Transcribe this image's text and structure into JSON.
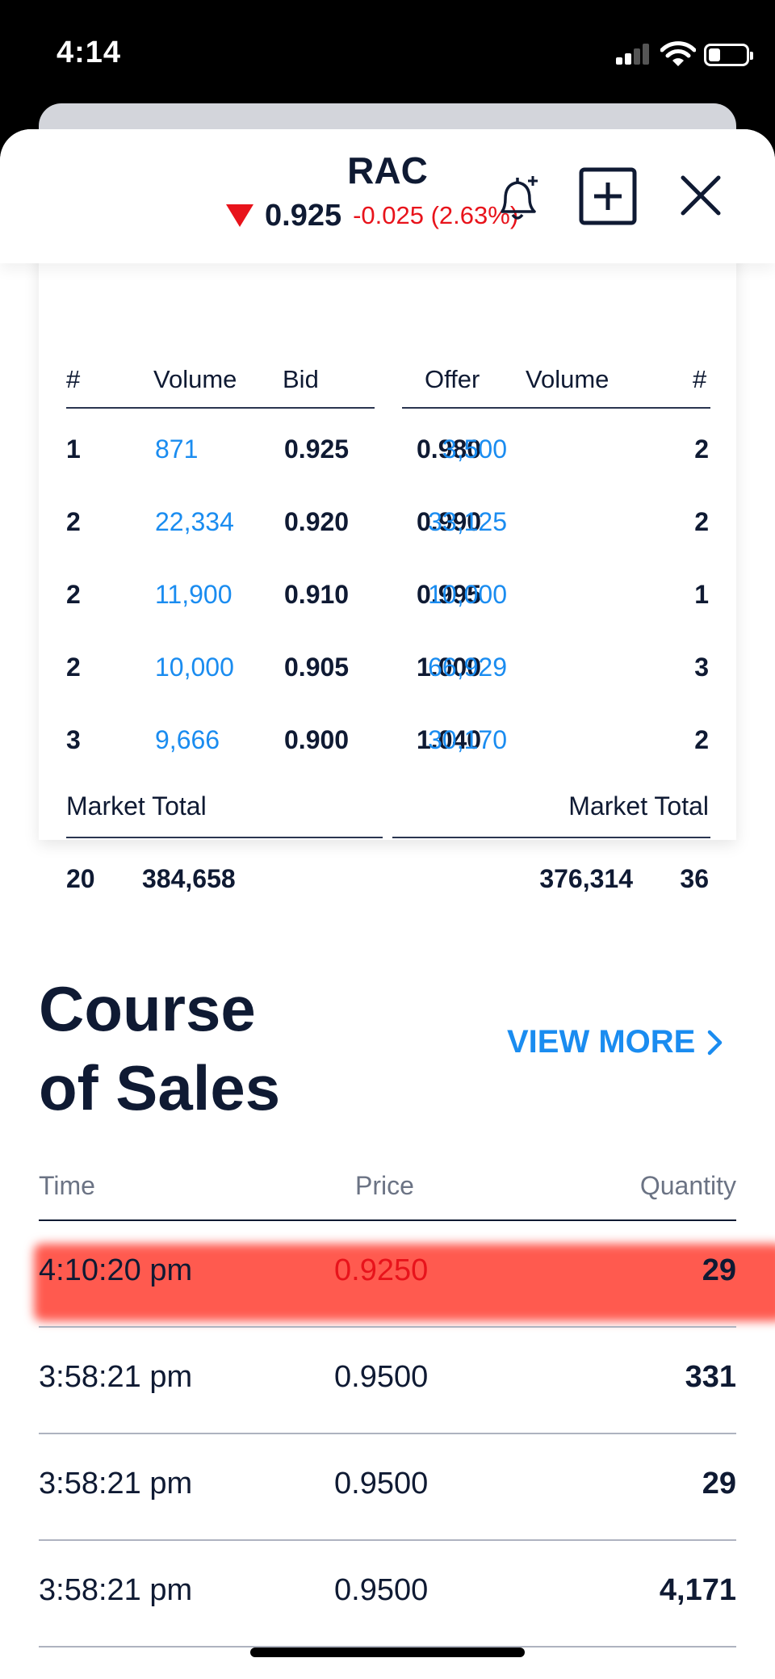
{
  "status_bar": {
    "time": "4:14"
  },
  "header": {
    "ticker": "RAC",
    "last_price": "0.925",
    "change": "-0.025 (2.63%)",
    "direction": "down",
    "colors": {
      "down": "#e8131b",
      "text": "#0f1a33"
    }
  },
  "depth": {
    "headers": {
      "count_left": "#",
      "volume_left": "Volume",
      "bid": "Bid",
      "offer": "Offer",
      "volume_right": "Volume",
      "count_right": "#"
    },
    "rows": [
      {
        "bid_count": "1",
        "bid_volume": "871",
        "bid": "0.925",
        "offer": "0.980",
        "offer_volume": "3,500",
        "offer_count": "2"
      },
      {
        "bid_count": "2",
        "bid_volume": "22,334",
        "bid": "0.920",
        "offer": "0.990",
        "offer_volume": "33,125",
        "offer_count": "2"
      },
      {
        "bid_count": "2",
        "bid_volume": "11,900",
        "bid": "0.910",
        "offer": "0.995",
        "offer_volume": "10,000",
        "offer_count": "1"
      },
      {
        "bid_count": "2",
        "bid_volume": "10,000",
        "bid": "0.905",
        "offer": "1.000",
        "offer_volume": "66,929",
        "offer_count": "3"
      },
      {
        "bid_count": "3",
        "bid_volume": "9,666",
        "bid": "0.900",
        "offer": "1.040",
        "offer_volume": "30,170",
        "offer_count": "2"
      }
    ],
    "market_total_label_left": "Market Total",
    "market_total_label_right": "Market Total",
    "totals": {
      "bid_count": "20",
      "bid_volume": "384,658",
      "offer_volume": "376,314",
      "offer_count": "36"
    },
    "accent": "#1a8cf0"
  },
  "course_of_sales": {
    "title_line1": "Course",
    "title_line2": "of Sales",
    "view_more": "VIEW MORE",
    "columns": {
      "time": "Time",
      "price": "Price",
      "quantity": "Quantity"
    },
    "rows": [
      {
        "time": "4:10:20 pm",
        "price": "0.9250",
        "quantity": "29",
        "highlighted": true
      },
      {
        "time": "3:58:21 pm",
        "price": "0.9500",
        "quantity": "331"
      },
      {
        "time": "3:58:21 pm",
        "price": "0.9500",
        "quantity": "29"
      },
      {
        "time": "3:58:21 pm",
        "price": "0.9500",
        "quantity": "4,171"
      }
    ]
  }
}
